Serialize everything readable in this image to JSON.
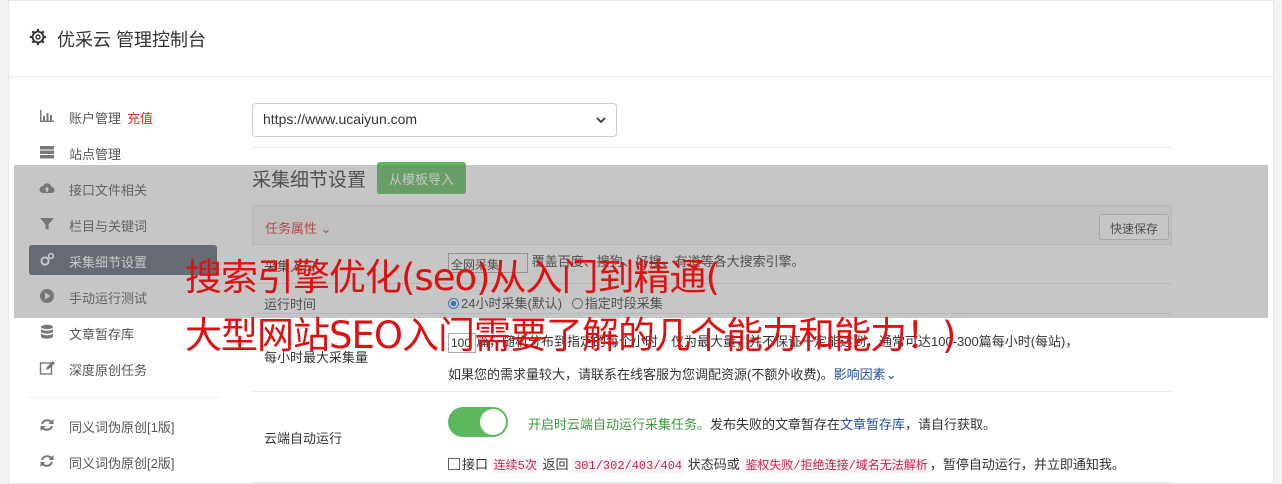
{
  "header": {
    "title": "优采云 管理控制台"
  },
  "sidebar": {
    "items": [
      {
        "label": "账户管理",
        "extra": "充值"
      },
      {
        "label": "站点管理"
      },
      {
        "label": "接口文件相关"
      },
      {
        "label": "栏目与关键词"
      },
      {
        "label": "采集细节设置"
      },
      {
        "label": "手动运行测试"
      },
      {
        "label": "文章暂存库"
      },
      {
        "label": "深度原创任务"
      },
      {
        "label": "同义词伪原创[1版]"
      },
      {
        "label": "同义词伪原创[2版]"
      }
    ]
  },
  "main": {
    "site_select": "https://www.ucaiyun.com",
    "section_title": "采集细节设置",
    "import_button": "从模板导入",
    "task_attr": "任务属性",
    "quick_save": "快速保存",
    "row1": {
      "label": "采集入口",
      "select": "全网采集",
      "text": "覆盖百度、搜狗、好搜、有道等各大搜索引擎。"
    },
    "row2": {
      "label": "运行时间",
      "opt1": "24小时采集(默认)",
      "opt2": "指定时段采集"
    },
    "row3": {
      "label": "每小时最大采集量",
      "value": "100",
      "text1a": "篇，随机分布到指定的每个小时，仅为最大量，并不保证一定能达到，通常可达100-300篇每小时(每站)，",
      "text2": "如果您的需求量较大，请联系在线客服为您调配资源(不额外收费)。",
      "link": "影响因素"
    },
    "row4": {
      "label": "云端自动运行",
      "desc_green": "开启时云端自动运行采集任务。",
      "desc_rest": "发布失败的文章暂存在",
      "desc_link": "文章暂存库",
      "desc_end": "，请自行获取。",
      "chk_label": "接口",
      "code1": "连续5次",
      "t1": "返回",
      "code2": "301/302/403/404",
      "t2": "状态码或",
      "code3": "鉴权失败/拒绝连接/域名无法解析",
      "t3": "，暂停自动运行，并立即通知我。"
    }
  },
  "watermark": {
    "line1": "搜索引擎优化(seo)从入门到精通(",
    "line2": "大型网站SEO入门需要了解的几个能力和能力！)"
  },
  "colors": {
    "accent_green": "#5cb85c",
    "active_bg": "#5a6270",
    "danger": "#d9312c"
  }
}
